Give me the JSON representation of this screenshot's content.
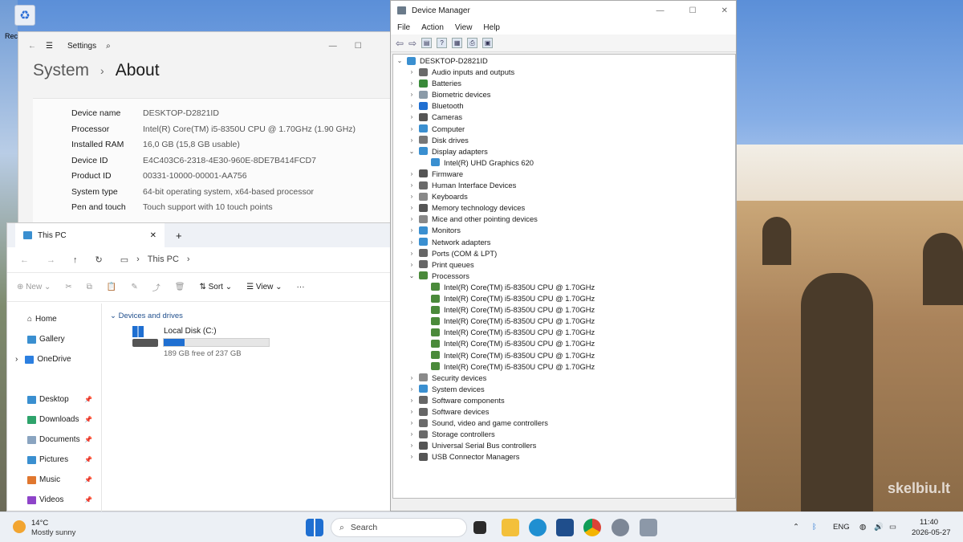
{
  "desktop": {
    "recycle_label": "Rec",
    "watermark": "skelbiu.lt"
  },
  "settings": {
    "app_title": "Settings",
    "crumb": "System",
    "page": "About",
    "rows": [
      {
        "label": "Device name",
        "value": "DESKTOP-D2821ID"
      },
      {
        "label": "Processor",
        "value": "Intel(R) Core(TM) i5-8350U CPU @ 1.70GHz (1.90 GHz)"
      },
      {
        "label": "Installed RAM",
        "value": "16,0 GB (15,8 GB usable)"
      },
      {
        "label": "Device ID",
        "value": "E4C403C6-2318-4E30-960E-8DE7B414FCD7"
      },
      {
        "label": "Product ID",
        "value": "00331-10000-00001-AA756"
      },
      {
        "label": "System type",
        "value": "64-bit operating system, x64-based processor"
      },
      {
        "label": "Pen and touch",
        "value": "Touch support with 10 touch points"
      }
    ]
  },
  "explorer": {
    "tab_title": "This PC",
    "address": "This PC",
    "toolbar": {
      "new": "New",
      "sort": "Sort",
      "view": "View"
    },
    "nav": {
      "home": "Home",
      "gallery": "Gallery",
      "onedrive": "OneDrive",
      "desktop": "Desktop",
      "downloads": "Downloads",
      "documents": "Documents",
      "pictures": "Pictures",
      "music": "Music",
      "videos": "Videos"
    },
    "section": "Devices and drives",
    "drive": {
      "name": "Local Disk (C:)",
      "free": "189 GB free of 237 GB",
      "used_fraction": 0.2
    }
  },
  "devmgr": {
    "title": "Device Manager",
    "menu": [
      "File",
      "Action",
      "View",
      "Help"
    ],
    "root": "DESKTOP-D2821ID",
    "nodes": [
      {
        "label": "Audio inputs and outputs",
        "icon": "#6a6a6a",
        "level": 1,
        "exp": ">"
      },
      {
        "label": "Batteries",
        "icon": "#3a8a3a",
        "level": 1,
        "exp": ">"
      },
      {
        "label": "Biometric devices",
        "icon": "#8a9aa8",
        "level": 1,
        "exp": ">"
      },
      {
        "label": "Bluetooth",
        "icon": "#1f6fd1",
        "level": 1,
        "exp": ">"
      },
      {
        "label": "Cameras",
        "icon": "#555555",
        "level": 1,
        "exp": ">"
      },
      {
        "label": "Computer",
        "icon": "#3a8fd0",
        "level": 1,
        "exp": ">"
      },
      {
        "label": "Disk drives",
        "icon": "#777777",
        "level": 1,
        "exp": ">"
      },
      {
        "label": "Display adapters",
        "icon": "#3a8fd0",
        "level": 1,
        "exp": "v"
      },
      {
        "label": "Intel(R) UHD Graphics 620",
        "icon": "#3a8fd0",
        "level": 2,
        "exp": ""
      },
      {
        "label": "Firmware",
        "icon": "#555555",
        "level": 1,
        "exp": ">"
      },
      {
        "label": "Human Interface Devices",
        "icon": "#6a6a6a",
        "level": 1,
        "exp": ">"
      },
      {
        "label": "Keyboards",
        "icon": "#888888",
        "level": 1,
        "exp": ">"
      },
      {
        "label": "Memory technology devices",
        "icon": "#555555",
        "level": 1,
        "exp": ">"
      },
      {
        "label": "Mice and other pointing devices",
        "icon": "#888888",
        "level": 1,
        "exp": ">"
      },
      {
        "label": "Monitors",
        "icon": "#3a8fd0",
        "level": 1,
        "exp": ">"
      },
      {
        "label": "Network adapters",
        "icon": "#3a8fd0",
        "level": 1,
        "exp": ">"
      },
      {
        "label": "Ports (COM & LPT)",
        "icon": "#666666",
        "level": 1,
        "exp": ">"
      },
      {
        "label": "Print queues",
        "icon": "#666666",
        "level": 1,
        "exp": ">"
      },
      {
        "label": "Processors",
        "icon": "#4a8a3a",
        "level": 1,
        "exp": "v"
      },
      {
        "label": "Intel(R) Core(TM) i5-8350U CPU @ 1.70GHz",
        "icon": "#4a8a3a",
        "level": 2,
        "exp": ""
      },
      {
        "label": "Intel(R) Core(TM) i5-8350U CPU @ 1.70GHz",
        "icon": "#4a8a3a",
        "level": 2,
        "exp": ""
      },
      {
        "label": "Intel(R) Core(TM) i5-8350U CPU @ 1.70GHz",
        "icon": "#4a8a3a",
        "level": 2,
        "exp": ""
      },
      {
        "label": "Intel(R) Core(TM) i5-8350U CPU @ 1.70GHz",
        "icon": "#4a8a3a",
        "level": 2,
        "exp": ""
      },
      {
        "label": "Intel(R) Core(TM) i5-8350U CPU @ 1.70GHz",
        "icon": "#4a8a3a",
        "level": 2,
        "exp": ""
      },
      {
        "label": "Intel(R) Core(TM) i5-8350U CPU @ 1.70GHz",
        "icon": "#4a8a3a",
        "level": 2,
        "exp": ""
      },
      {
        "label": "Intel(R) Core(TM) i5-8350U CPU @ 1.70GHz",
        "icon": "#4a8a3a",
        "level": 2,
        "exp": ""
      },
      {
        "label": "Intel(R) Core(TM) i5-8350U CPU @ 1.70GHz",
        "icon": "#4a8a3a",
        "level": 2,
        "exp": ""
      },
      {
        "label": "Security devices",
        "icon": "#8a8a8a",
        "level": 1,
        "exp": ">"
      },
      {
        "label": "System devices",
        "icon": "#3a8fd0",
        "level": 1,
        "exp": ">"
      },
      {
        "label": "Software components",
        "icon": "#666666",
        "level": 1,
        "exp": ">"
      },
      {
        "label": "Software devices",
        "icon": "#666666",
        "level": 1,
        "exp": ">"
      },
      {
        "label": "Sound, video and game controllers",
        "icon": "#6a6a6a",
        "level": 1,
        "exp": ">"
      },
      {
        "label": "Storage controllers",
        "icon": "#6a6a6a",
        "level": 1,
        "exp": ">"
      },
      {
        "label": "Universal Serial Bus controllers",
        "icon": "#555555",
        "level": 1,
        "exp": ">"
      },
      {
        "label": "USB Connector Managers",
        "icon": "#555555",
        "level": 1,
        "exp": ">"
      }
    ]
  },
  "taskbar": {
    "weather_temp": "14°C",
    "weather_desc": "Mostly sunny",
    "search": "Search",
    "lang": "ENG",
    "time": "11:40",
    "date": "2026-05-27"
  }
}
